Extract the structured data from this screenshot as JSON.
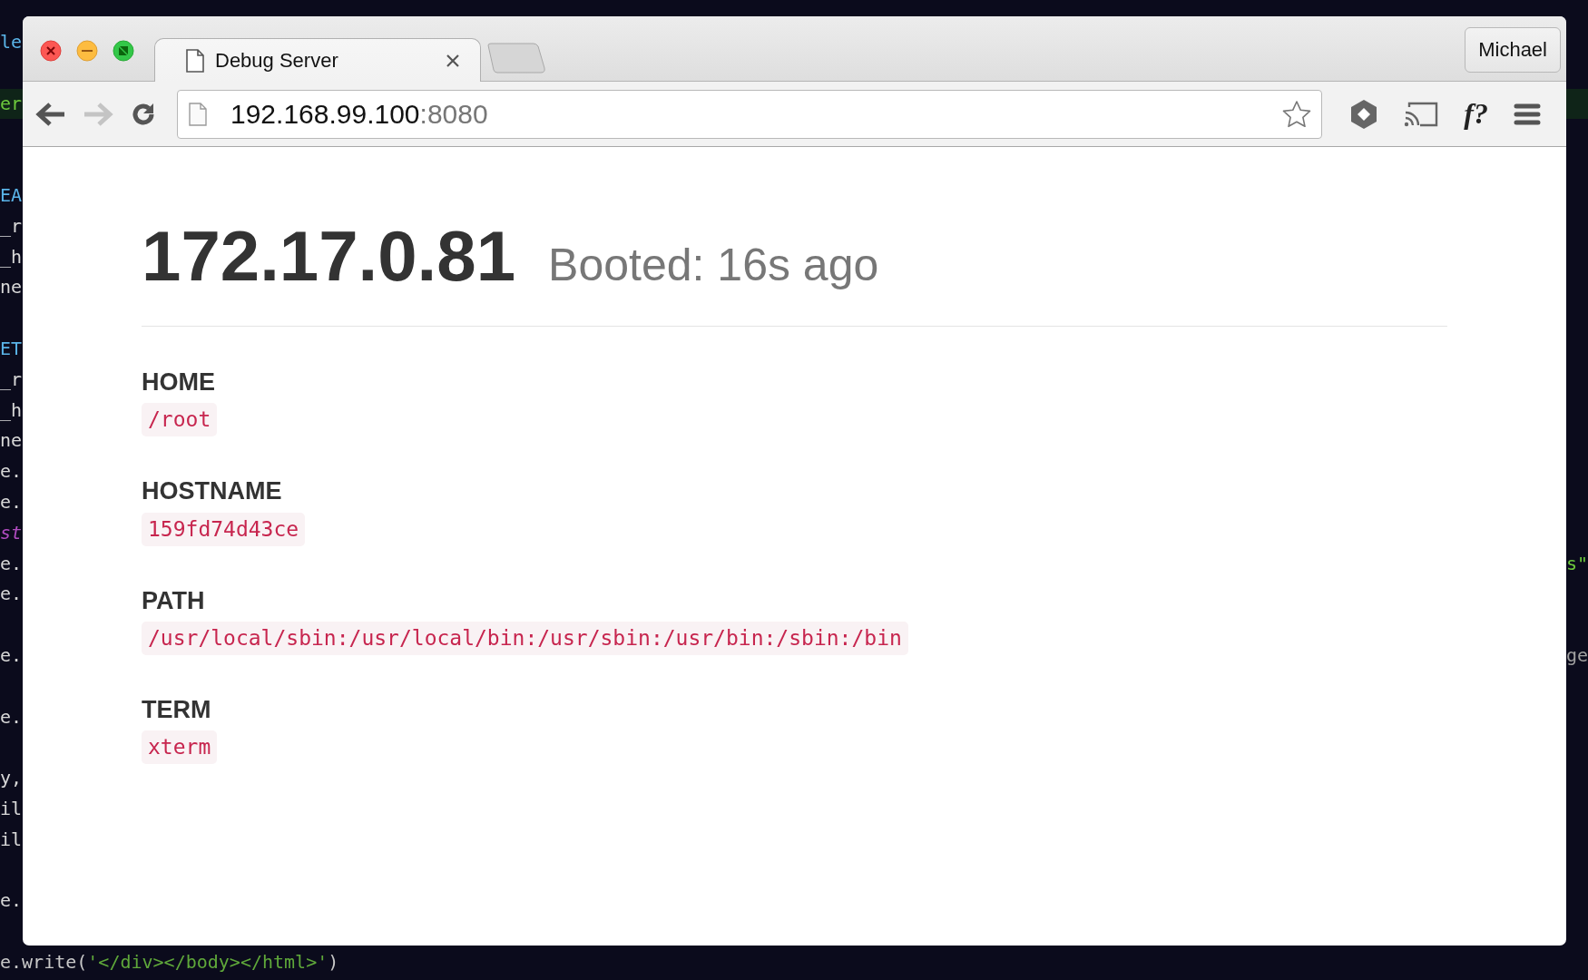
{
  "terminal": {
    "lines": [
      {
        "kind": "code",
        "left": [
          {
            "text": "le",
            "color": "#5ab4e8"
          }
        ]
      },
      {
        "kind": "blank"
      },
      {
        "kind": "code",
        "left": [
          {
            "text": "er",
            "color": "#6cc83c"
          }
        ]
      },
      {
        "kind": "blank"
      },
      {
        "kind": "blank"
      },
      {
        "kind": "code",
        "left": [
          {
            "text": "EA",
            "color": "#5ab4e8"
          }
        ]
      },
      {
        "kind": "code",
        "left": [
          {
            "text": "_r",
            "color": "#d8d8d8"
          }
        ]
      },
      {
        "kind": "code",
        "left": [
          {
            "text": "_h",
            "color": "#d8d8d8"
          }
        ]
      },
      {
        "kind": "code",
        "left": [
          {
            "text": "ne",
            "color": "#d8d8d8"
          }
        ]
      },
      {
        "kind": "blank"
      },
      {
        "kind": "code",
        "left": [
          {
            "text": "ET",
            "color": "#5ab4e8"
          }
        ]
      },
      {
        "kind": "code",
        "left": [
          {
            "text": "_r",
            "color": "#d8d8d8"
          }
        ]
      },
      {
        "kind": "code",
        "left": [
          {
            "text": "_h",
            "color": "#d8d8d8"
          }
        ]
      },
      {
        "kind": "code",
        "left": [
          {
            "text": "ne",
            "color": "#d8d8d8"
          }
        ]
      },
      {
        "kind": "code",
        "left": [
          {
            "text": "e.",
            "color": "#d8d8d8"
          }
        ]
      },
      {
        "kind": "code",
        "left": [
          {
            "text": "e.",
            "color": "#d8d8d8"
          }
        ]
      },
      {
        "kind": "code",
        "left": [
          {
            "text": "st",
            "color": "#b04cc0"
          }
        ]
      },
      {
        "kind": "code",
        "left": [
          {
            "text": "e.",
            "color": "#d8d8d8"
          }
        ],
        "right": [
          {
            "text": "s\"",
            "color": "#6cc83c"
          }
        ]
      },
      {
        "kind": "code",
        "left": [
          {
            "text": "e.",
            "color": "#d8d8d8"
          }
        ]
      },
      {
        "kind": "blank"
      },
      {
        "kind": "code",
        "left": [
          {
            "text": "e.",
            "color": "#d8d8d8"
          }
        ],
        "right": [
          {
            "text": "ge",
            "color": "#a0a0a0"
          }
        ]
      },
      {
        "kind": "blank"
      },
      {
        "kind": "code",
        "left": [
          {
            "text": "e.",
            "color": "#d8d8d8"
          }
        ]
      },
      {
        "kind": "blank"
      },
      {
        "kind": "code",
        "left": [
          {
            "text": "y,",
            "color": "#d8d8d8"
          }
        ]
      },
      {
        "kind": "code",
        "left": [
          {
            "text": "il",
            "color": "#d8d8d8"
          }
        ]
      },
      {
        "kind": "code",
        "left": [
          {
            "text": "il",
            "color": "#d8d8d8"
          }
        ]
      },
      {
        "kind": "blank"
      },
      {
        "kind": "code",
        "left": [
          {
            "text": "e.",
            "color": "#d8d8d8"
          }
        ]
      },
      {
        "kind": "blank"
      },
      {
        "kind": "code",
        "left": [
          {
            "text": "e.write(",
            "color": "#c8c8c8"
          },
          {
            "text": "'</div></body></html>'",
            "color": "#5fa83a"
          },
          {
            "text": ")",
            "color": "#c8c8c8"
          }
        ]
      }
    ]
  },
  "tabs": [
    {
      "title": "Debug Server",
      "selected": true
    }
  ],
  "profile": "Michael",
  "toolbar": {
    "back": {
      "disabled": false
    },
    "forward": {
      "disabled": true
    },
    "address": {
      "host": "192.168.99.100",
      "port": ":8080"
    },
    "extensions": [
      {
        "kind": "hexagon"
      },
      {
        "kind": "cast"
      },
      {
        "kind": "text",
        "label": "f?"
      }
    ]
  },
  "page": {
    "heading": "172.17.0.81",
    "subheading": "Booted: 16s ago",
    "variables": [
      {
        "name": "HOME",
        "value": "/root"
      },
      {
        "name": "HOSTNAME",
        "value": "159fd74d43ce"
      },
      {
        "name": "PATH",
        "value": "/usr/local/sbin:/usr/local/bin:/usr/sbin:/usr/bin:/sbin:/bin"
      },
      {
        "name": "TERM",
        "value": "xterm"
      }
    ]
  }
}
